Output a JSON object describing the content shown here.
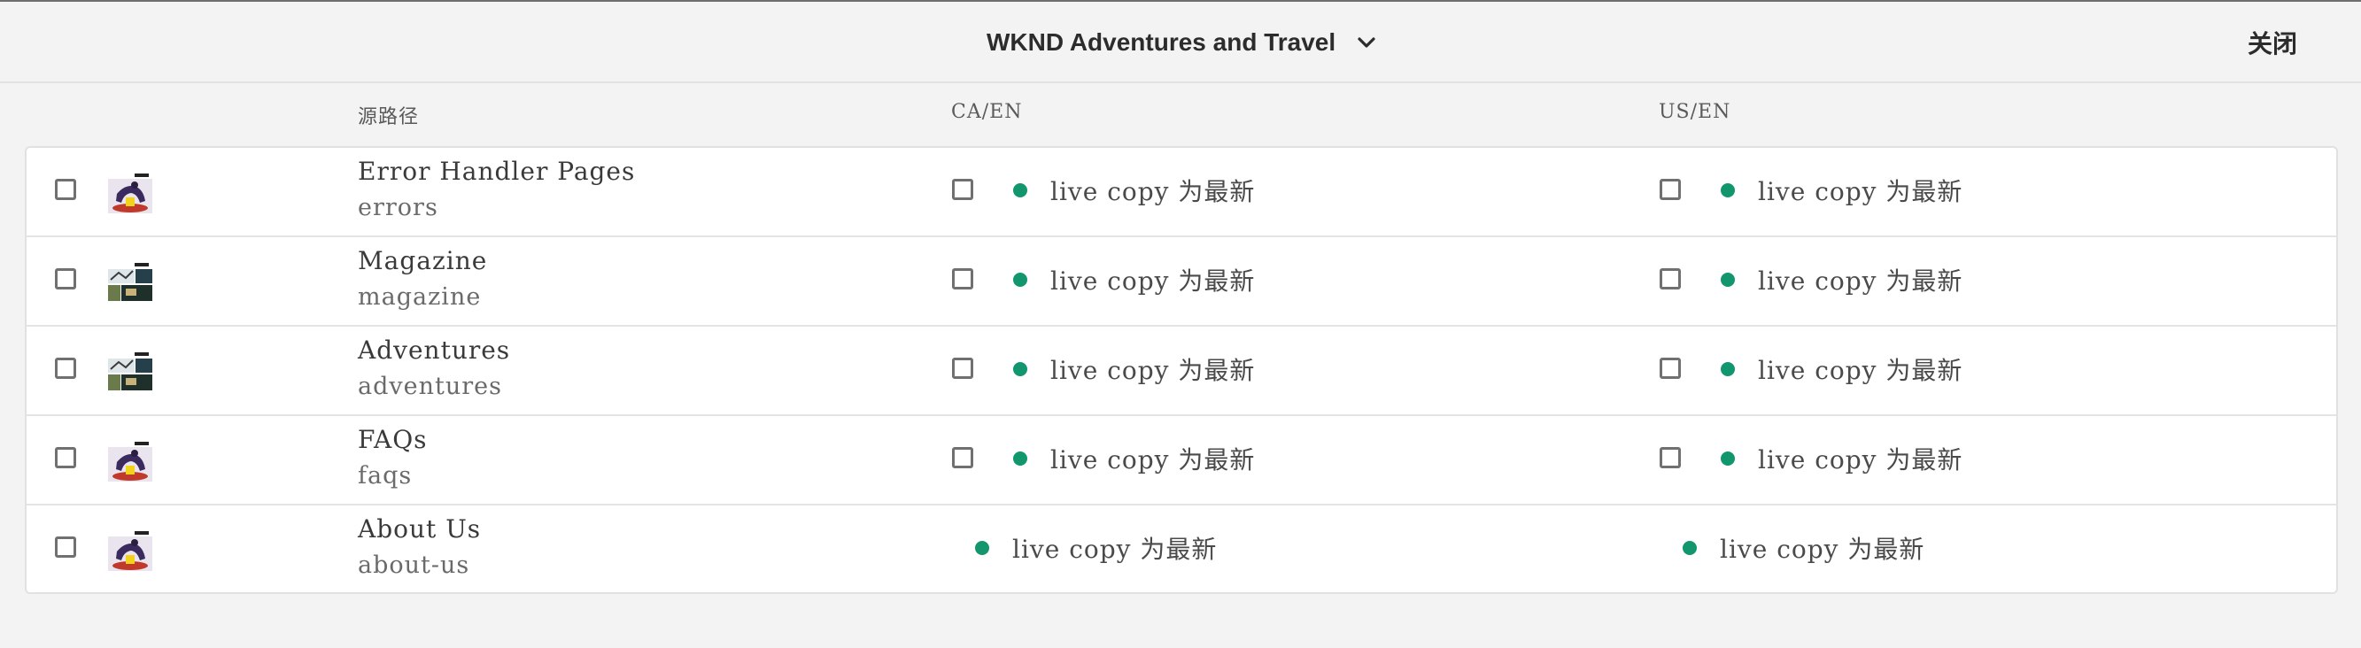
{
  "header": {
    "title": "WKND Adventures and Travel",
    "close_label": "关闭"
  },
  "columns": {
    "source_path": "源路径",
    "ca_en": "CA/EN",
    "us_en": "US/EN"
  },
  "status_color": "#12966e",
  "rows": [
    {
      "title": "Error Handler Pages",
      "name": "errors",
      "thumb": "runner",
      "ca_status": "live copy 为最新",
      "us_status": "live copy 为最新",
      "ca_checkbox": true,
      "us_checkbox": true
    },
    {
      "title": "Magazine",
      "name": "magazine",
      "thumb": "landscape",
      "ca_status": "live copy 为最新",
      "us_status": "live copy 为最新",
      "ca_checkbox": true,
      "us_checkbox": true
    },
    {
      "title": "Adventures",
      "name": "adventures",
      "thumb": "landscape",
      "ca_status": "live copy 为最新",
      "us_status": "live copy 为最新",
      "ca_checkbox": true,
      "us_checkbox": true
    },
    {
      "title": "FAQs",
      "name": "faqs",
      "thumb": "runner",
      "ca_status": "live copy 为最新",
      "us_status": "live copy 为最新",
      "ca_checkbox": true,
      "us_checkbox": true
    },
    {
      "title": "About Us",
      "name": "about-us",
      "thumb": "runner",
      "ca_status": "live copy 为最新",
      "us_status": "live copy 为最新",
      "ca_checkbox": false,
      "us_checkbox": false
    }
  ]
}
